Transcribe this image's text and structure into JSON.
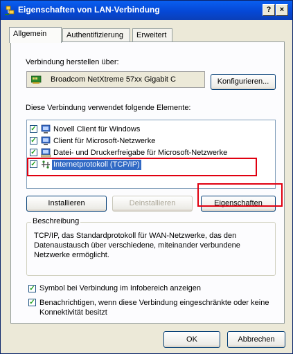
{
  "window": {
    "title": "Eigenschaften von LAN-Verbindung",
    "help_label": "?",
    "close_label": "×"
  },
  "tabs": [
    {
      "label": "Allgemein",
      "active": true
    },
    {
      "label": "Authentifizierung",
      "active": false
    },
    {
      "label": "Erweitert",
      "active": false
    }
  ],
  "connect_using": {
    "label": "Verbindung herstellen über:",
    "adapter_name": "Broadcom NetXtreme 57xx Gigabit C",
    "configure_label": "Konfigurieren..."
  },
  "components": {
    "label": "Diese Verbindung verwendet folgende Elemente:",
    "items": [
      {
        "label": "Novell Client für Windows",
        "checked": true,
        "icon": "client-icon"
      },
      {
        "label": "Client für Microsoft-Netzwerke",
        "checked": true,
        "icon": "client-icon"
      },
      {
        "label": "Datei- und Druckerfreigabe für Microsoft-Netzwerke",
        "checked": true,
        "icon": "service-icon"
      },
      {
        "label": "Internetprotokoll (TCP/IP)",
        "checked": true,
        "icon": "protocol-icon",
        "selected": true
      }
    ],
    "check_mark": "✓"
  },
  "actions": {
    "install_label": "Installieren",
    "uninstall_label": "Deinstallieren",
    "properties_label": "Eigenschaften"
  },
  "description": {
    "legend": "Beschreibung",
    "text": "TCP/IP, das Standardprotokoll für WAN-Netzwerke, das den Datenaustausch über verschiedene, miteinander verbundene Netzwerke ermöglicht."
  },
  "options": {
    "show_icon_label": "Symbol bei Verbindung im Infobereich anzeigen",
    "show_icon_checked": true,
    "notify_label": "Benachrichtigen, wenn diese Verbindung eingeschränkte oder keine Konnektivität besitzt",
    "notify_checked": true
  },
  "footer": {
    "ok_label": "OK",
    "cancel_label": "Abbrechen"
  },
  "colors": {
    "titlebar": "#0548d6",
    "selection": "#316ac5",
    "highlight_annotation": "#e00010"
  }
}
